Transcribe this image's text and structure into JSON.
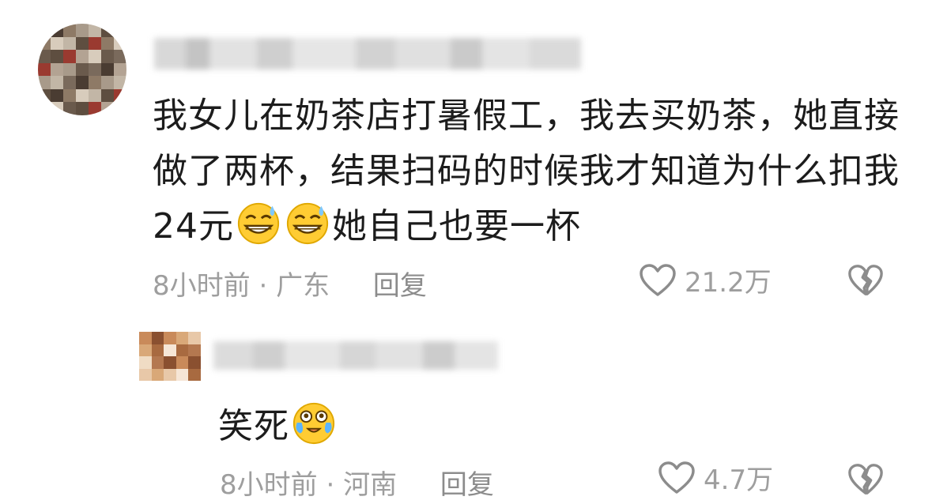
{
  "comment": {
    "text_part1": "我女儿在奶茶店打暑假工，我去买奶茶，她直接做了两杯，结果扫码的时候我才知道为什么扣我24元",
    "text_part2": "她自己也要一杯",
    "emojis": [
      "grinning-sweat-emoji",
      "grinning-sweat-emoji"
    ],
    "time": "8小时前",
    "separator": "·",
    "location": "广东",
    "reply_label": "回复",
    "like_count": "21.2万"
  },
  "reply": {
    "text": "笑死",
    "emoji": "crying-laughing-emoji",
    "time": "8小时前",
    "separator": "·",
    "location": "河南",
    "reply_label": "回复",
    "like_count": "4.7万"
  },
  "colors": {
    "text": "#1c1c1c",
    "meta": "#9e9e9e",
    "background": "#ffffff"
  }
}
